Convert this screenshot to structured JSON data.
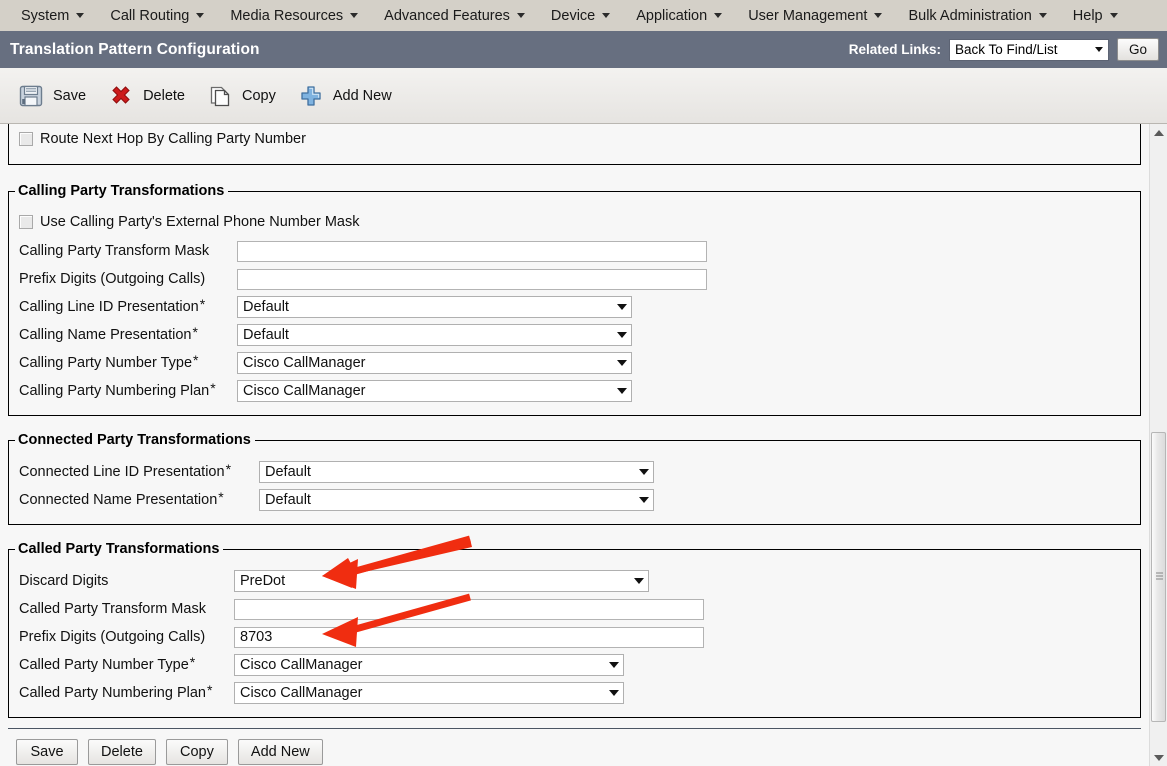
{
  "menubar": {
    "items": [
      {
        "label": "System",
        "icon": "chevron-down-icon"
      },
      {
        "label": "Call Routing",
        "icon": "chevron-down-icon"
      },
      {
        "label": "Media Resources",
        "icon": "chevron-down-icon"
      },
      {
        "label": "Advanced Features",
        "icon": "chevron-down-icon"
      },
      {
        "label": "Device",
        "icon": "chevron-down-icon"
      },
      {
        "label": "Application",
        "icon": "chevron-down-icon"
      },
      {
        "label": "User Management",
        "icon": "chevron-down-icon"
      },
      {
        "label": "Bulk Administration",
        "icon": "chevron-down-icon"
      },
      {
        "label": "Help",
        "icon": "chevron-down-icon"
      }
    ]
  },
  "titlebar": {
    "title": "Translation Pattern Configuration",
    "related_links_label": "Related Links:",
    "related_links_value": "Back To Find/List",
    "go_label": "Go",
    "bg_color": "#676f80"
  },
  "toolbar": {
    "buttons": [
      {
        "label": "Save",
        "icon": "save-floppy-icon"
      },
      {
        "label": "Delete",
        "icon": "delete-x-icon"
      },
      {
        "label": "Copy",
        "icon": "copy-pages-icon"
      },
      {
        "label": "Add New",
        "icon": "add-plus-icon"
      }
    ]
  },
  "sections": {
    "top_partial": {
      "checkbox_label": "Route Next Hop By Calling Party Number",
      "checked": false
    },
    "calling": {
      "legend": "Calling Party Transformations",
      "checkbox_label": "Use Calling Party's External Phone Number Mask",
      "checked": false,
      "fields": [
        {
          "label": "Calling Party Transform Mask",
          "required": false,
          "type": "text",
          "value": ""
        },
        {
          "label": "Prefix Digits (Outgoing Calls)",
          "required": false,
          "type": "text",
          "value": ""
        },
        {
          "label": "Calling Line ID Presentation",
          "required": true,
          "type": "select",
          "value": "Default"
        },
        {
          "label": "Calling Name Presentation",
          "required": true,
          "type": "select",
          "value": "Default"
        },
        {
          "label": "Calling Party Number Type",
          "required": true,
          "type": "select",
          "value": "Cisco CallManager"
        },
        {
          "label": "Calling Party Numbering Plan",
          "required": true,
          "type": "select",
          "value": "Cisco CallManager"
        }
      ]
    },
    "connected": {
      "legend": "Connected Party Transformations",
      "fields": [
        {
          "label": "Connected Line ID Presentation",
          "required": true,
          "type": "select",
          "value": "Default"
        },
        {
          "label": "Connected Name Presentation",
          "required": true,
          "type": "select",
          "value": "Default"
        }
      ]
    },
    "called": {
      "legend": "Called Party Transformations",
      "fields": [
        {
          "label": "Discard Digits",
          "required": false,
          "type": "select",
          "value": "PreDot"
        },
        {
          "label": "Called Party Transform Mask",
          "required": false,
          "type": "text",
          "value": ""
        },
        {
          "label": "Prefix Digits (Outgoing Calls)",
          "required": false,
          "type": "text",
          "value": "8703"
        },
        {
          "label": "Called Party Number Type",
          "required": true,
          "type": "select",
          "value": "Cisco CallManager"
        },
        {
          "label": "Called Party Numbering Plan",
          "required": true,
          "type": "select",
          "value": "Cisco CallManager"
        }
      ]
    }
  },
  "footer_buttons": [
    {
      "label": "Save"
    },
    {
      "label": "Delete"
    },
    {
      "label": "Copy"
    },
    {
      "label": "Add New"
    }
  ],
  "annotations": {
    "color": "#f02d10",
    "arrows": [
      {
        "name": "arrow-pointing-discard-digits",
        "target": "Discard Digits = PreDot"
      },
      {
        "name": "arrow-pointing-prefix-digits",
        "target": "Prefix Digits (Outgoing Calls) = 8703"
      }
    ]
  },
  "scrollbar": {
    "up_icon": "triangle-up-icon",
    "down_icon": "triangle-down-icon",
    "orientation": "vertical"
  }
}
